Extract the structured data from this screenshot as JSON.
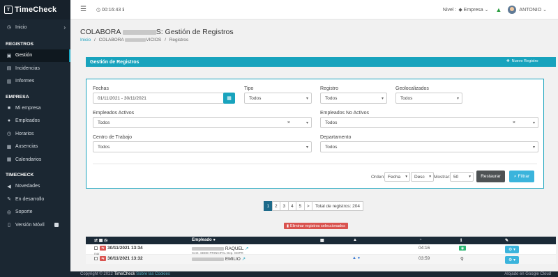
{
  "brand": {
    "name_bold": "TimeCheck",
    "logo_letter": "T"
  },
  "sidebar": {
    "home": "Inicio",
    "sections": [
      {
        "title": "REGISTROS",
        "items": [
          {
            "label": "Gestión",
            "icon": "folder-icon",
            "glyph": "▣"
          },
          {
            "label": "Incidencias",
            "icon": "document-icon",
            "glyph": "▤"
          },
          {
            "label": "Informes",
            "icon": "chart-icon",
            "glyph": "▥"
          }
        ]
      },
      {
        "title": "EMPRESA",
        "items": [
          {
            "label": "Mi empresa",
            "icon": "briefcase-icon",
            "glyph": "■"
          },
          {
            "label": "Empleados",
            "icon": "users-icon",
            "glyph": "●"
          },
          {
            "label": "Horarios",
            "icon": "clock-icon",
            "glyph": "◷"
          },
          {
            "label": "Ausencias",
            "icon": "calendar-icon",
            "glyph": "▦"
          },
          {
            "label": "Calendarios",
            "icon": "calendar-icon",
            "glyph": "▦"
          }
        ]
      },
      {
        "title": "TIMECHECK",
        "items": [
          {
            "label": "Novedades",
            "icon": "megaphone-icon",
            "glyph": "◀"
          },
          {
            "label": "En desarrollo",
            "icon": "wrench-icon",
            "glyph": "✎"
          },
          {
            "label": "Soporte",
            "icon": "support-icon",
            "glyph": "◎"
          },
          {
            "label": "Versión Móvil",
            "icon": "mobile-icon",
            "glyph": "▯"
          }
        ]
      }
    ]
  },
  "topbar": {
    "timer": "00:16:43",
    "level_label": "Nivel :",
    "level_value": "Empresa",
    "user": "ANTONIO"
  },
  "page": {
    "title_start": "COLABORA",
    "title_end": "S: Gestión de Registros",
    "crumb_home": "Inicio",
    "crumb_company": "COLABORA",
    "crumb_company_end": "VICIOS",
    "crumb_current": "Registros"
  },
  "panel": {
    "title": "Gestión de Registros",
    "new_button": "Nuevo Registro"
  },
  "filters": {
    "dates_label": "Fechas",
    "dates_value": "01/11/2021 - 30/11/2021",
    "tipo_label": "Tipo",
    "tipo_value": "Todos",
    "registro_label": "Registro",
    "registro_value": "Todos",
    "geo_label": "Geolocalizados",
    "geo_value": "Todos",
    "activos_label": "Empleados Activos",
    "activos_value": "Todos",
    "noactivos_label": "Empleados No Activos",
    "noactivos_value": "Todos",
    "centro_label": "Centro de Trabajo",
    "centro_value": "Todos",
    "depto_label": "Departamento",
    "depto_value": "Todos",
    "order_label": "Orden:",
    "order_value": "Fecha",
    "dir_value": "Desc",
    "show_label": "Mostrar:",
    "show_value": "50",
    "reset_button": "Restaurar",
    "filter_button": "Filtrar"
  },
  "pagination": {
    "pages": [
      "1",
      "2",
      "3",
      "4",
      "5",
      ">"
    ],
    "total": "Total de registros: 204"
  },
  "delete_button": "Eliminar registros seleccionados",
  "table": {
    "empleado_header": "Empleado",
    "rows": [
      {
        "datetime": "30/11/2021 13:34",
        "sub": "mar",
        "name_end": "RAQUEL",
        "dept": "Cent. SEDE PRINCIPAL Dep. GDPR",
        "time": "04:16"
      },
      {
        "datetime": "30/11/2021 13:32",
        "sub": "",
        "name_end": "EMILIO",
        "dept": "",
        "time": "03:59"
      }
    ]
  },
  "footer": {
    "copyright": "Copyright © 2022",
    "brand": "TimeCheck",
    "link1": "Sobre",
    "link2": "las Cookies",
    "right": "Alojado en Google Cloud"
  }
}
